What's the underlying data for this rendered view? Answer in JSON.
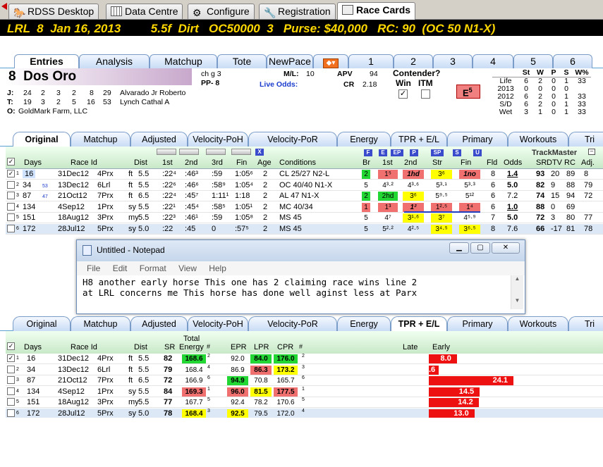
{
  "top_tabs": [
    {
      "label": "RDSS Desktop",
      "icon": "horse-icon"
    },
    {
      "label": "Data Centre",
      "icon": "grid-icon"
    },
    {
      "label": "Configure",
      "icon": "gear-icon"
    },
    {
      "label": "Registration",
      "icon": "wrench-icon"
    },
    {
      "label": "Race Cards",
      "icon": "card-icon",
      "active": true
    }
  ],
  "race": {
    "header": "LRL  8  Jan 16, 2013         5.5f  Dirt   OC50000  3   Purse: $40,000   RC: 90  (OC 50 N1-X)"
  },
  "card_tabs": [
    "Entries",
    "Analysis",
    "Matchup",
    "Tote",
    "NewPace",
    "",
    "1",
    "2",
    "3",
    "4",
    "5",
    "6"
  ],
  "horse": {
    "number": "8",
    "name": "Dos Oro",
    "desc": "ch g 3",
    "pp": "PP- 8",
    "ml_label": "M/L:",
    "ml": "10",
    "live_odds": "Live Odds:",
    "apv_label": "APV",
    "apv": "94",
    "cr_label": "CR",
    "cr": "2.18",
    "contender_label": "Contender?",
    "win_label": "Win",
    "itm_label": "ITM",
    "e_rating": "E",
    "e_num": "5",
    "jockey": {
      "label": "J:",
      "stats": [
        "24",
        "2",
        "3",
        "2",
        "8",
        "29"
      ],
      "name": "Alvarado Jr Roberto"
    },
    "trainer": {
      "label": "T:",
      "stats": [
        "19",
        "3",
        "2",
        "5",
        "16",
        "53"
      ],
      "name": "Lynch Cathal A"
    },
    "owner": {
      "label": "O:",
      "name": "GoldMark Farm, LLC"
    }
  },
  "record": {
    "headers": [
      "",
      "St",
      "W",
      "P",
      "S",
      "W%"
    ],
    "rows": [
      [
        "Life",
        "6",
        "2",
        "0",
        "1",
        "33"
      ],
      [
        "2013",
        "0",
        "0",
        "0",
        "0",
        ""
      ],
      [
        "2012",
        "6",
        "2",
        "0",
        "1",
        "33"
      ],
      [
        "S/D",
        "6",
        "2",
        "0",
        "1",
        "33"
      ],
      [
        "Wet",
        "3",
        "1",
        "0",
        "1",
        "33"
      ]
    ]
  },
  "grid_tabs": [
    "Original",
    "Matchup",
    "Adjusted",
    "Velocity-PoH",
    "Velocity-PoR",
    "Energy",
    "TPR + E/L",
    "Primary",
    "Workouts",
    "Tri"
  ],
  "grid1": {
    "headers": {
      "days": "Days",
      "raceid": "Race Id",
      "dist": "Dist",
      "q1": "1st",
      "q2": "2nd",
      "q3": "3rd",
      "fin": "Fin",
      "age": "Age",
      "cond": "Conditions",
      "br": "Br",
      "c1": "1st",
      "c2": "2nd",
      "str": "Str",
      "fn": "Fin",
      "fld": "Fld",
      "odds": "Odds",
      "tm": "TrackMaster",
      "srd": "SR",
      "dtv": "DTV",
      "rc": "RC",
      "adj": "Adj."
    },
    "filters": [
      "F",
      "E",
      "EP",
      "P",
      "SP",
      "S",
      "U"
    ],
    "x": "X",
    "rows": [
      {
        "n": "1",
        "chk": true,
        "days": "16",
        "sub": "",
        "date": "31Dec12",
        "race": "4Prx",
        "surf": "ft",
        "dist": "5.5",
        "q1": ":22⁴",
        "q2": ":46³",
        "q3": ":59",
        "fin": "1:05⁶",
        "age": "2",
        "cond": "CL 25/27 N2-L",
        "br": "2",
        "brc": "g",
        "c1": "1⁵",
        "c1c": "r",
        "c2": "1hd",
        "c2c": "r",
        "str": "3⁶",
        "strc": "y",
        "fn": "1no",
        "fnc": "r",
        "fld": "8",
        "odds": "1.4",
        "oddsb": true,
        "sr": "93",
        "dtv": "20",
        "rc": "89",
        "adj": "8"
      },
      {
        "n": "2",
        "chk": false,
        "days": "34",
        "sub": "53",
        "date": "13Dec12",
        "race": "6Lrl",
        "surf": "ft",
        "dist": "5.5",
        "q1": ":22⁶",
        "q2": ":46⁶",
        "q3": ":58⁹",
        "fin": "1:05⁴",
        "age": "2",
        "cond": "OC 40/40 N1-X",
        "br": "5",
        "brc": "",
        "c1": "4³·²",
        "c1c": "",
        "c2": "4³·⁶",
        "c2c": "",
        "str": "5³·¹",
        "strc": "",
        "fn": "5³·³",
        "fnc": "",
        "fld": "6",
        "odds": "5.0",
        "oddsb": true,
        "sr": "82",
        "dtv": "9",
        "rc": "88",
        "adj": "79"
      },
      {
        "n": "3",
        "chk": false,
        "days": "87",
        "sub": "47",
        "date": "21Oct12",
        "race": "7Prx",
        "surf": "ft",
        "dist": "6.5",
        "q1": ":22⁴",
        "q2": ":45⁷",
        "q3": "1:11¹",
        "fin": "1:18",
        "age": "2",
        "cond": "AL 47 N1-X",
        "br": "2",
        "brc": "g",
        "c1": "2hd",
        "c1c": "g",
        "c2": "3⁶",
        "c2c": "y",
        "str": "5⁹·⁵",
        "strc": "",
        "fn": "5¹²",
        "fnc": "",
        "fld": "6",
        "odds": "7.2",
        "oddsb": false,
        "sr": "74",
        "dtv": "15",
        "rc": "94",
        "adj": "72"
      },
      {
        "n": "4",
        "chk": false,
        "days": "134",
        "sub": "",
        "date": "4Sep12",
        "race": "1Prx",
        "surf": "sy",
        "dist": "5.5",
        "q1": ":22¹",
        "q2": ":45⁴",
        "q3": ":58⁵",
        "fin": "1:05¹",
        "age": "2",
        "cond": "MC 40/34",
        "br": "1",
        "brc": "r",
        "c1": "1³",
        "c1c": "r",
        "c2": "1²",
        "c2c": "r",
        "str": "1²·⁵",
        "strc": "r",
        "fn": "1⁴",
        "fnc": "r",
        "fld": "6",
        "odds": "1.0",
        "oddsb": true,
        "sr": "88",
        "dtv": "0",
        "rc": "69",
        "adj": ""
      },
      {
        "n": "5",
        "chk": false,
        "days": "151",
        "sub": "",
        "date": "18Aug12",
        "race": "3Prx",
        "surf": "my",
        "dist": "5.5",
        "q1": ":22³",
        "q2": ":46¹",
        "q3": ":59",
        "fin": "1:05⁸",
        "age": "2",
        "cond": "MS 45",
        "br": "5",
        "brc": "",
        "c1": "4⁷",
        "c1c": "",
        "c2": "3¹·⁶",
        "c2c": "y",
        "str": "3⁷",
        "strc": "y",
        "fn": "4⁵·⁹",
        "fnc": "",
        "fld": "7",
        "odds": "5.0",
        "oddsb": true,
        "sr": "72",
        "dtv": "3",
        "rc": "80",
        "adj": "77"
      },
      {
        "n": "6",
        "chk": false,
        "days": "172",
        "sub": "",
        "date": "28Jul12",
        "race": "5Prx",
        "surf": "sy",
        "dist": "5.0",
        "q1": ":22",
        "q2": ":45",
        "q3": "0",
        "fin": ":57⁵",
        "age": "2",
        "cond": "MS 45",
        "br": "5",
        "brc": "",
        "c1": "5²·²",
        "c1c": "",
        "c2": "4²·⁵",
        "c2c": "",
        "str": "3⁴·⁵",
        "strc": "y",
        "fn": "3⁶·⁵",
        "fnc": "y",
        "fld": "8",
        "odds": "7.6",
        "oddsb": false,
        "sr": "66",
        "dtv": "-17",
        "rc": "81",
        "adj": "78"
      }
    ]
  },
  "notepad": {
    "title": "Untitled - Notepad",
    "menu": [
      "File",
      "Edit",
      "Format",
      "View",
      "Help"
    ],
    "line1": "H8 another early horse This one has 2 claiming race wins line 2",
    "line2": "at LRL concerns me This horse has done well aginst less at Parx"
  },
  "grid2": {
    "headers": {
      "days": "Days",
      "raceid": "Race Id",
      "dist": "Dist",
      "sr": "SR",
      "total1": "Total",
      "total2": "Energy",
      "hash": "#",
      "epr": "EPR",
      "lpr": "LPR",
      "cpr": "CPR",
      "hash2": "#",
      "late": "Late",
      "early": "Early"
    },
    "chart_data": {
      "type": "bar",
      "categories": [
        "1",
        "2",
        "3",
        "4",
        "5",
        "6"
      ],
      "values": [
        8.0,
        0.6,
        24.1,
        14.5,
        14.2,
        13.0
      ],
      "labels": [
        "8.0",
        ".6",
        "24.1",
        "14.5",
        "14.2",
        "13.0"
      ],
      "xlim": [
        0,
        24.1
      ]
    },
    "rows": [
      {
        "n": "1",
        "chk": true,
        "days": "16",
        "date": "31Dec12",
        "race": "4Prx",
        "surf": "ft",
        "dist": "5.5",
        "sr": "82",
        "te": "168.6",
        "tn": "2",
        "tec": "g",
        "epr": "92.0",
        "eprc": "",
        "lpr": "84.0",
        "lprc": "g",
        "cpr": "176.0",
        "cprc": "g",
        "cn": "2"
      },
      {
        "n": "2",
        "chk": false,
        "days": "34",
        "date": "13Dec12",
        "race": "6Lrl",
        "surf": "ft",
        "dist": "5.5",
        "sr": "79",
        "te": "168.4",
        "tn": "4",
        "tec": "",
        "epr": "86.9",
        "eprc": "",
        "lpr": "86.3",
        "lprc": "r",
        "cpr": "173.2",
        "cprc": "y",
        "cn": "3"
      },
      {
        "n": "3",
        "chk": false,
        "days": "87",
        "date": "21Oct12",
        "race": "7Prx",
        "surf": "ft",
        "dist": "6.5",
        "sr": "72",
        "te": "166.9",
        "tn": "6",
        "tec": "",
        "epr": "94.9",
        "eprc": "g",
        "lpr": "70.8",
        "lprc": "",
        "cpr": "165.7",
        "cprc": "",
        "cn": "6"
      },
      {
        "n": "4",
        "chk": false,
        "days": "134",
        "date": "4Sep12",
        "race": "1Prx",
        "surf": "sy",
        "dist": "5.5",
        "sr": "84",
        "te": "169.3",
        "tn": "1",
        "tec": "r",
        "epr": "96.0",
        "eprc": "r",
        "lpr": "81.5",
        "lprc": "y",
        "cpr": "177.5",
        "cprc": "r",
        "cn": "1"
      },
      {
        "n": "5",
        "chk": false,
        "days": "151",
        "date": "18Aug12",
        "race": "3Prx",
        "surf": "my",
        "dist": "5.5",
        "sr": "77",
        "te": "167.7",
        "tn": "5",
        "tec": "",
        "epr": "92.4",
        "eprc": "",
        "lpr": "78.2",
        "lprc": "",
        "cpr": "170.6",
        "cprc": "",
        "cn": "5"
      },
      {
        "n": "6",
        "chk": false,
        "days": "172",
        "date": "28Jul12",
        "race": "5Prx",
        "surf": "sy",
        "dist": "5.0",
        "sr": "78",
        "te": "168.4",
        "tn": "3",
        "tec": "y",
        "epr": "92.5",
        "eprc": "y",
        "lpr": "79.5",
        "lprc": "",
        "cpr": "172.0",
        "cprc": "",
        "cn": "4"
      }
    ]
  },
  "colors": {
    "green": "#22d633",
    "red": "#f07070",
    "yellow": "#ffff00",
    "bar": "#ee1111",
    "header_bg": "#000000",
    "header_text": "#ffd800"
  }
}
